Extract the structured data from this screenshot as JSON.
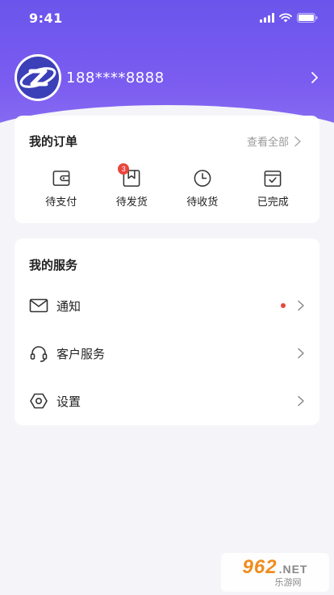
{
  "status_bar": {
    "time": "9:41"
  },
  "profile": {
    "phone": "188****8888"
  },
  "orders": {
    "title": "我的订单",
    "view_all": "查看全部",
    "items": [
      {
        "label": "待支付",
        "icon": "wallet-icon"
      },
      {
        "label": "待发货",
        "icon": "package-icon",
        "badge": "3"
      },
      {
        "label": "待收货",
        "icon": "clock-icon"
      },
      {
        "label": "已完成",
        "icon": "check-calendar-icon"
      }
    ]
  },
  "services": {
    "title": "我的服务",
    "items": [
      {
        "label": "通知",
        "icon": "mail-icon",
        "has_dot": true
      },
      {
        "label": "客户服务",
        "icon": "headset-icon"
      },
      {
        "label": "设置",
        "icon": "settings-icon"
      }
    ]
  },
  "colors": {
    "header_gradient_top": "#6a55ec",
    "header_gradient_bottom": "#8a6ff2",
    "badge": "#e9453c",
    "background": "#f5f5f9"
  },
  "watermark": {
    "brand": "962",
    "suffix": ".NET",
    "tagline": "乐游网"
  }
}
